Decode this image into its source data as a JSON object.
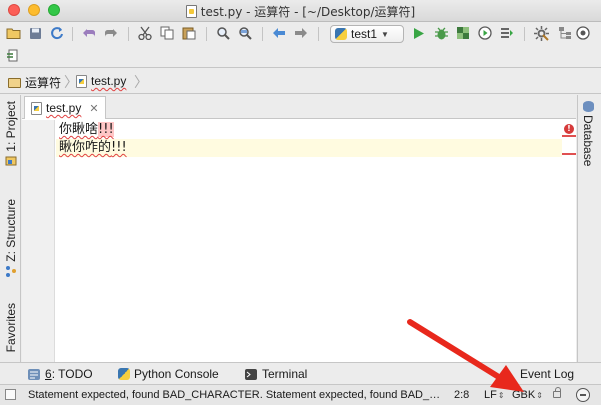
{
  "window": {
    "title": "test.py - 运算符 - [~/Desktop/运算符]"
  },
  "toolbar": {
    "run_config": "test1",
    "icons": [
      "open-folder-icon",
      "save-icon",
      "sync-icon",
      "undo-icon",
      "redo-icon",
      "cut-icon",
      "copy-icon",
      "paste-icon",
      "find-icon",
      "replace-icon",
      "back-icon",
      "forward-icon",
      "run-icon",
      "debug-icon",
      "coverage-icon",
      "profile-icon",
      "concurrency-icon",
      "settings-icon",
      "structure-icon",
      "vcs-icon"
    ]
  },
  "navbar": {
    "crumbs": [
      "运算符",
      "test.py"
    ]
  },
  "left_tools": {
    "project": "1: Project",
    "structure": "Z: Structure",
    "favorites": "Favorites"
  },
  "right_tools": {
    "database": "Database"
  },
  "editor": {
    "tab_label": "test.py",
    "lines": [
      {
        "text": "你瞅啥",
        "bad": "!!!"
      },
      {
        "text": "瞅你咋的",
        "bad": "!!!"
      }
    ]
  },
  "tool_windows": {
    "todo_num": "6",
    "todo_label": ": TODO",
    "python_console": "Python Console",
    "terminal": "Terminal",
    "event_log": "Event Log"
  },
  "status": {
    "message": "Statement expected, found BAD_CHARACTER. Statement expected, found BAD_CHARACTER. Statement expected, found BA...",
    "position": "2:8",
    "line_separator": "LF",
    "encoding": "GBK"
  },
  "colors": {
    "annotation_arrow": "#e8281c",
    "error": "#d63b3b",
    "current_line": "#fffbe0"
  }
}
